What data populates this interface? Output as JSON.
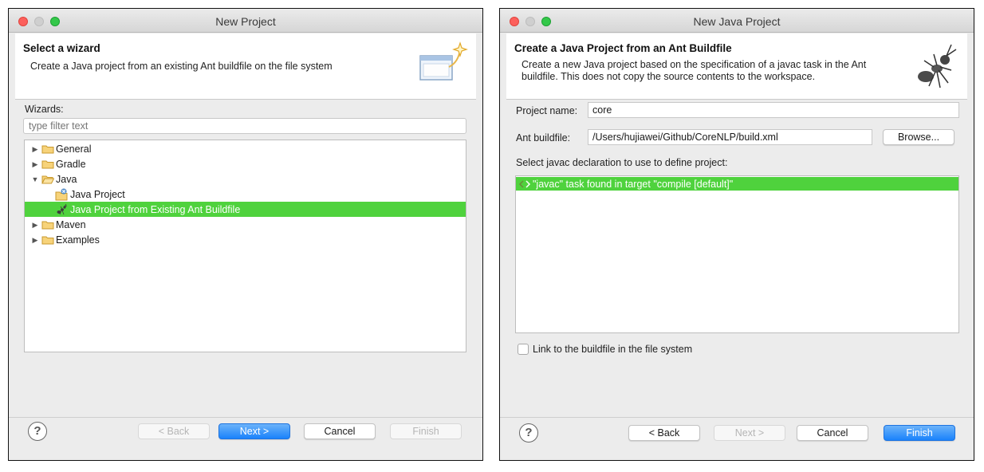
{
  "wizard": {
    "window_title": "New Project",
    "banner": {
      "title": "Select a wizard",
      "description": "Create a Java project from an existing Ant buildfile on the file system"
    },
    "wizards_label": "Wizards:",
    "filter_placeholder": "type filter text",
    "tree": [
      {
        "label": "General",
        "type": "folder",
        "expanded": false
      },
      {
        "label": "Gradle",
        "type": "folder",
        "expanded": false
      },
      {
        "label": "Java",
        "type": "folder",
        "expanded": true
      },
      {
        "label": "Java Project",
        "type": "item",
        "icon": "java-project-icon"
      },
      {
        "label": "Java Project from Existing Ant Buildfile",
        "type": "item",
        "icon": "ant-icon",
        "selected": true
      },
      {
        "label": "Maven",
        "type": "folder",
        "expanded": false
      },
      {
        "label": "Examples",
        "type": "folder",
        "expanded": false
      }
    ],
    "buttons": {
      "help": "?",
      "back": "< Back",
      "next": "Next >",
      "cancel": "Cancel",
      "finish": "Finish"
    }
  },
  "java_project": {
    "window_title": "New Java Project",
    "banner": {
      "title": "Create a Java Project from an Ant Buildfile",
      "description_line1": "Create a new Java project based on the specification of a javac task in the Ant",
      "description_line2": "buildfile. This does not copy the source contents to the workspace."
    },
    "project_name_label": "Project name:",
    "project_name_value": "core",
    "ant_buildfile_label": "Ant buildfile:",
    "ant_buildfile_value": "/Users/hujiawei/Github/CoreNLP/build.xml",
    "browse_label": "Browse...",
    "select_label": "Select javac declaration to use to define project:",
    "declarations": [
      {
        "label": "\"javac\" task found in target \"compile [default]\"",
        "selected": true
      }
    ],
    "link_checkbox_label": "Link to the buildfile in the file system",
    "link_checked": false,
    "buttons": {
      "help": "?",
      "back": "< Back",
      "next": "Next >",
      "cancel": "Cancel",
      "finish": "Finish"
    }
  },
  "colors": {
    "selection": "#4fd23d",
    "primary_button": "#1a82fb"
  }
}
